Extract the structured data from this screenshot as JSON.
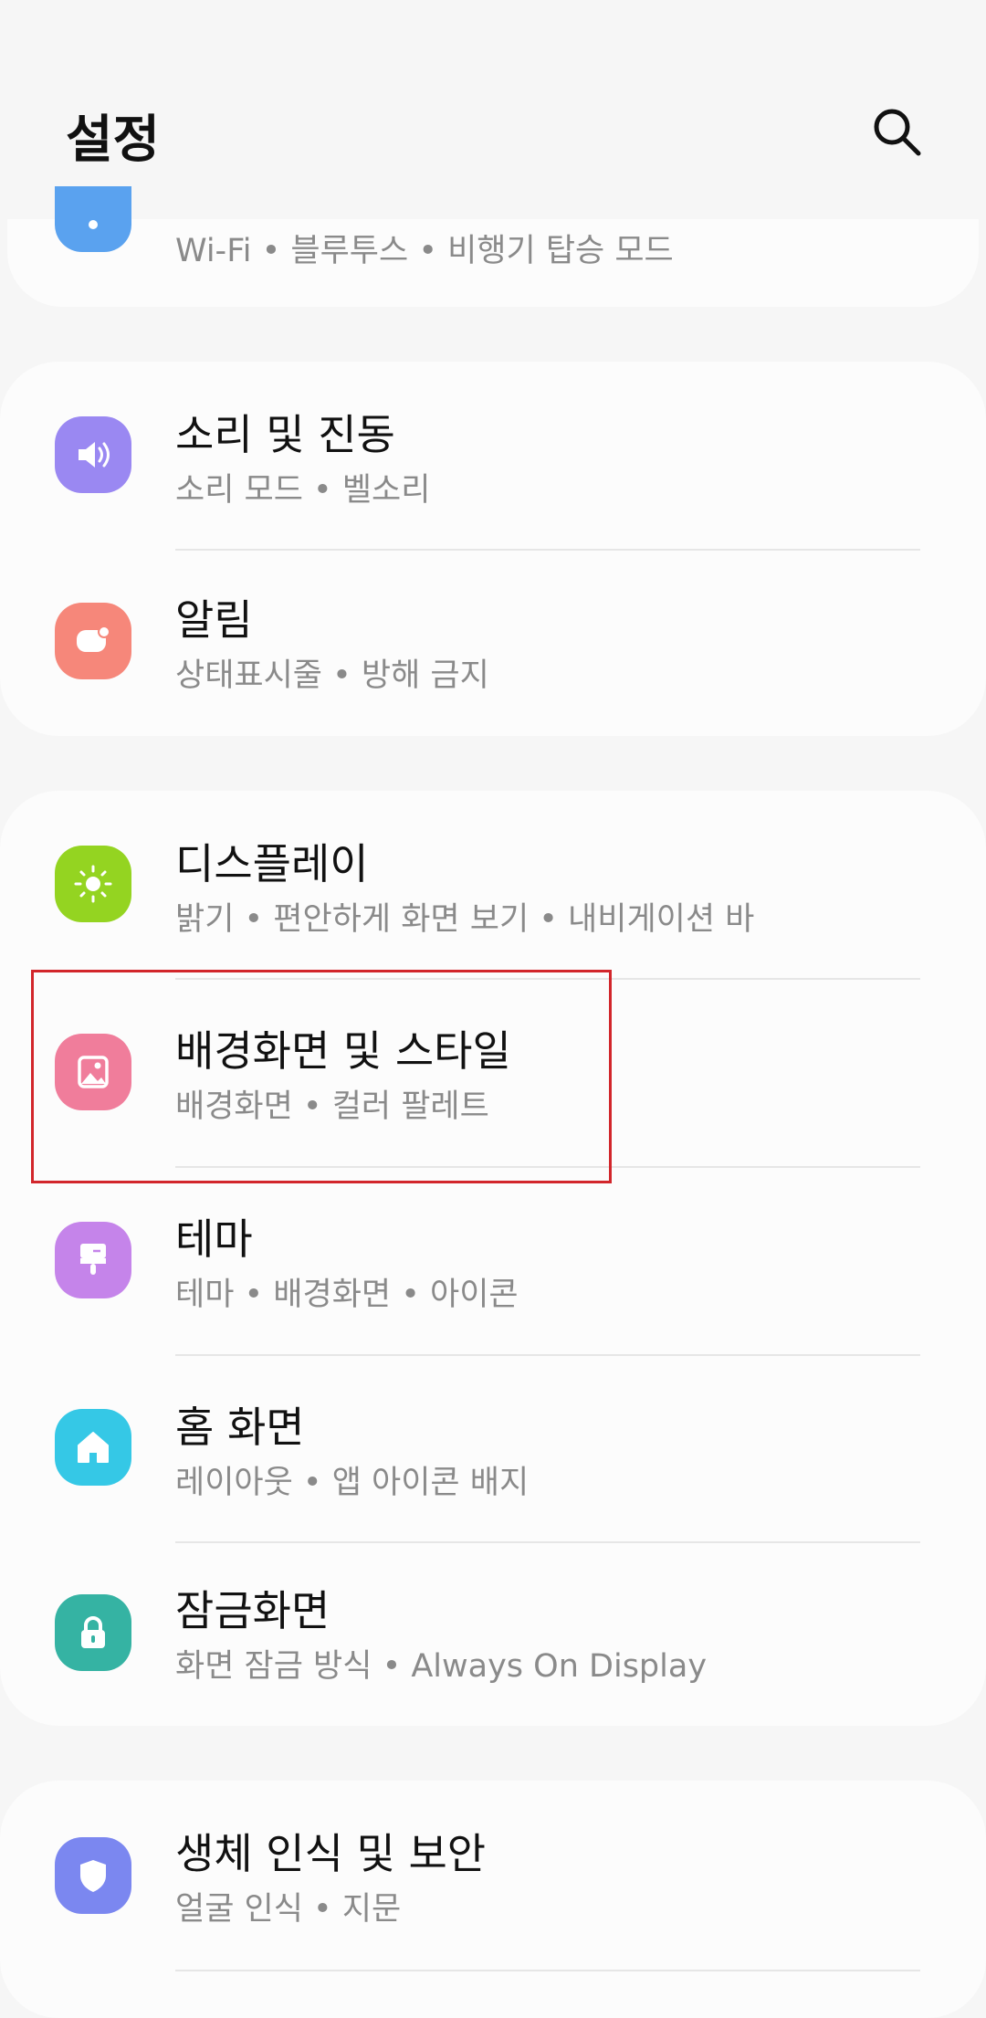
{
  "header": {
    "title": "설정"
  },
  "sections": [
    {
      "items": [
        {
          "title": "",
          "subtitle": "Wi-Fi  •  블루투스  •  비행기 탑승 모드",
          "icon": "wifi-icon",
          "color": "#5aa2ef"
        }
      ]
    },
    {
      "items": [
        {
          "title": "소리 및 진동",
          "subtitle": "소리 모드  •  벨소리",
          "icon": "speaker-icon",
          "color": "#9a88f2"
        },
        {
          "title": "알림",
          "subtitle": "상태표시줄  •  방해 금지",
          "icon": "notification-icon",
          "color": "#f6877a"
        }
      ]
    },
    {
      "items": [
        {
          "title": "디스플레이",
          "subtitle": "밝기  •  편안하게 화면 보기  •  내비게이션 바",
          "icon": "sun-icon",
          "color": "#94d421"
        },
        {
          "title": "배경화면 및 스타일",
          "subtitle": "배경화면  •  컬러 팔레트",
          "icon": "image-icon",
          "color": "#f07d9b"
        },
        {
          "title": "테마",
          "subtitle": "테마  •  배경화면  •  아이콘",
          "icon": "paintbrush-icon",
          "color": "#c584ea"
        },
        {
          "title": "홈 화면",
          "subtitle": "레이아웃  •  앱 아이콘 배지",
          "icon": "home-icon",
          "color": "#35c8e6"
        },
        {
          "title": "잠금화면",
          "subtitle": "화면 잠금 방식  •  Always On Display",
          "icon": "lock-icon",
          "color": "#35b3a3"
        }
      ]
    },
    {
      "items": [
        {
          "title": "생체 인식 및 보안",
          "subtitle": "얼굴 인식  •  지문",
          "icon": "shield-icon",
          "color": "#7b87f0"
        }
      ]
    }
  ]
}
